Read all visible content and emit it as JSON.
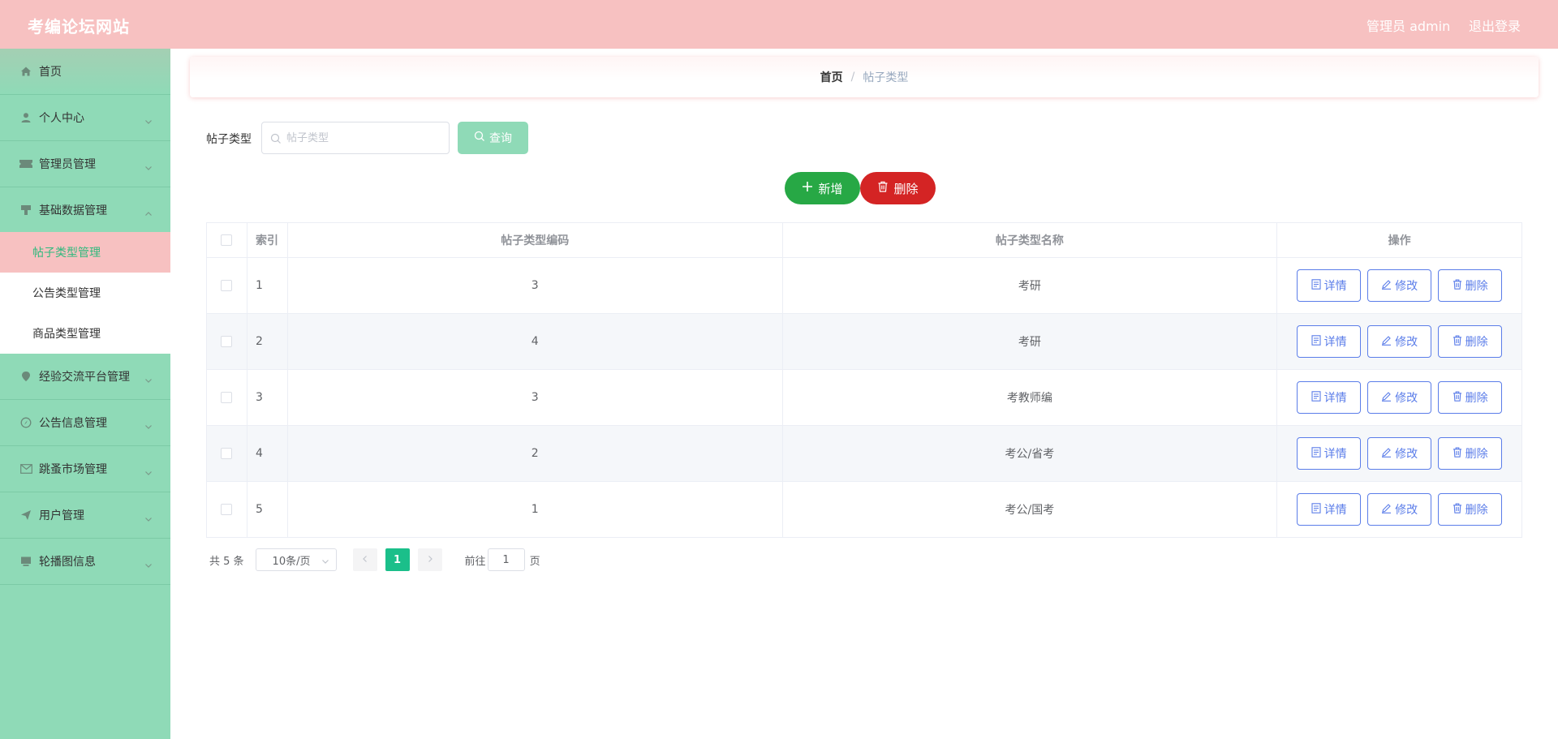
{
  "header": {
    "site_title": "考编论坛网站",
    "admin_text": "管理员 admin",
    "logout_label": "退出登录"
  },
  "sidebar": {
    "items": [
      {
        "label": "首页",
        "icon": "home-icon"
      },
      {
        "label": "个人中心",
        "icon": "user-icon"
      },
      {
        "label": "管理员管理",
        "icon": "ticket-icon"
      },
      {
        "label": "基础数据管理",
        "icon": "stamp-icon",
        "expanded": true
      },
      {
        "label": "经验交流平台管理",
        "icon": "location-icon"
      },
      {
        "label": "公告信息管理",
        "icon": "compass-icon"
      },
      {
        "label": "跳蚤市场管理",
        "icon": "message-icon"
      },
      {
        "label": "用户管理",
        "icon": "send-icon"
      },
      {
        "label": "轮播图信息",
        "icon": "monitor-icon"
      }
    ],
    "sub_items": [
      {
        "label": "帖子类型管理",
        "active": true
      },
      {
        "label": "公告类型管理"
      },
      {
        "label": "商品类型管理"
      }
    ]
  },
  "breadcrumb": {
    "home": "首页",
    "separator": "/",
    "current": "帖子类型"
  },
  "search": {
    "label": "帖子类型",
    "placeholder": "帖子类型",
    "value": "",
    "query_label": "查询"
  },
  "actions": {
    "add_label": "新增",
    "delete_label": "删除"
  },
  "table": {
    "headers": {
      "index": "索引",
      "code": "帖子类型编码",
      "name": "帖子类型名称",
      "ops": "操作"
    },
    "rows": [
      {
        "index": "1",
        "code": "3",
        "name": "考研"
      },
      {
        "index": "2",
        "code": "4",
        "name": "考研"
      },
      {
        "index": "3",
        "code": "3",
        "name": "考教师编"
      },
      {
        "index": "4",
        "code": "2",
        "name": "考公/省考"
      },
      {
        "index": "5",
        "code": "1",
        "name": "考公/国考"
      }
    ],
    "op_labels": {
      "detail": "详情",
      "edit": "修改",
      "delete": "删除"
    }
  },
  "pagination": {
    "total_text": "共 5 条",
    "page_size": "10条/页",
    "current_page": "1",
    "goto_label": "前往",
    "goto_value": "1",
    "page_unit": "页"
  },
  "colors": {
    "header_bg": "#f7c1c1",
    "sidebar_bg": "#8fdab7",
    "active_sub_bg": "#f7c1c1",
    "active_sub_text": "#2fb97d",
    "add_button": "#27a845",
    "delete_button": "#d42424",
    "op_button": "#5b7de9",
    "page_active": "#1bbf8a"
  }
}
